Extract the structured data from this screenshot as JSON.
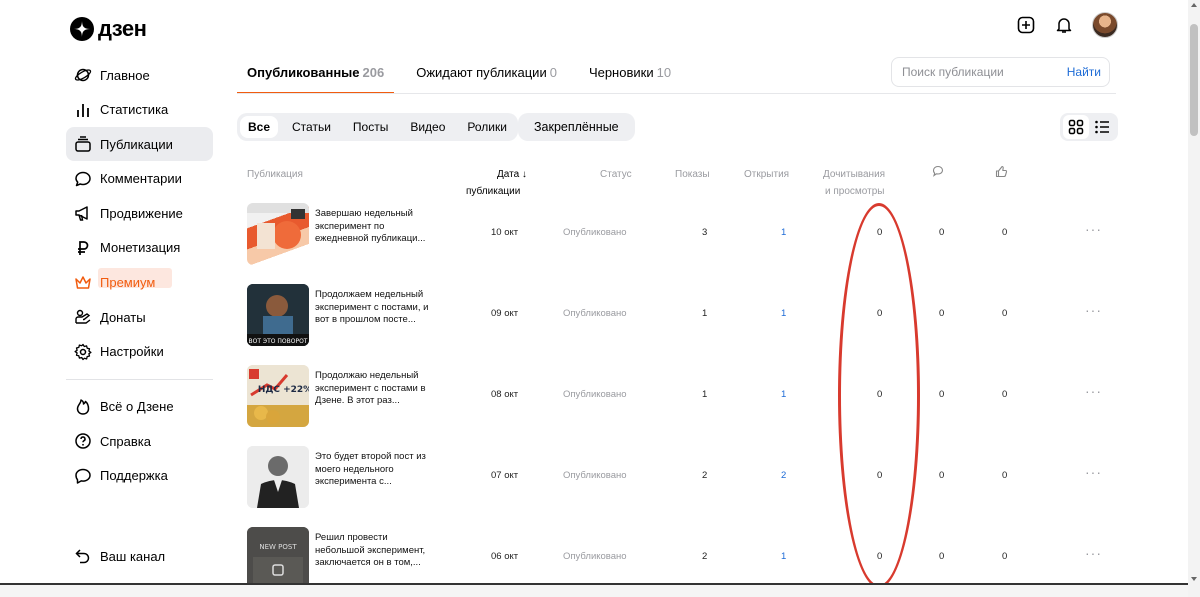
{
  "brand": {
    "name": "дзен"
  },
  "nav": {
    "items": [
      {
        "label": "Главное",
        "icon": "planet-icon"
      },
      {
        "label": "Статистика",
        "icon": "bar-chart-icon"
      },
      {
        "label": "Публикации",
        "icon": "stack-icon",
        "active": true
      },
      {
        "label": "Комментарии",
        "icon": "comment-icon"
      },
      {
        "label": "Продвижение",
        "icon": "megaphone-icon"
      },
      {
        "label": "Монетизация",
        "icon": "ruble-icon"
      },
      {
        "label": "Премиум",
        "icon": "crown-icon",
        "premium": true
      },
      {
        "label": "Донаты",
        "icon": "donate-icon"
      },
      {
        "label": "Настройки",
        "icon": "gear-icon"
      }
    ],
    "help": [
      {
        "label": "Всё о Дзене",
        "icon": "flame-icon"
      },
      {
        "label": "Справка",
        "icon": "question-icon"
      },
      {
        "label": "Поддержка",
        "icon": "support-icon"
      }
    ],
    "channel": {
      "label": "Ваш канал",
      "icon": "back-arrow-icon"
    }
  },
  "tabs": [
    {
      "label": "Опубликованные",
      "count": "206",
      "active": true
    },
    {
      "label": "Ожидают публикации",
      "count": "0"
    },
    {
      "label": "Черновики",
      "count": "10"
    }
  ],
  "search": {
    "placeholder": "Поиск публикации",
    "button": "Найти"
  },
  "filters": [
    "Все",
    "Статьи",
    "Посты",
    "Видео",
    "Ролики"
  ],
  "pinned_label": "Закреплённые",
  "table": {
    "headers": {
      "publication": "Публикация",
      "date_line1": "Дата",
      "date_line2": "публикации",
      "status": "Статус",
      "views": "Показы",
      "opens": "Открытия",
      "reads_line1": "Дочитывания",
      "reads_line2": "и просмотры"
    },
    "rows": [
      {
        "title": "Завершаю недельный эксперимент по ежедневной публикаци...",
        "date": "10 окт",
        "status": "Опубликовано",
        "views": "3",
        "opens": "1",
        "reads": "0",
        "comments": "0",
        "likes": "0"
      },
      {
        "title": "Продолжаем недельный эксперимент с постами, и вот в прошлом посте...",
        "date": "09 окт",
        "status": "Опубликовано",
        "views": "1",
        "opens": "1",
        "reads": "0",
        "comments": "0",
        "likes": "0",
        "thumb_caption": "ВОТ ЭТО ПОВОРОТ"
      },
      {
        "title": "Продолжаю недельный эксперимент с постами в Дзене. В этот раз...",
        "date": "08 окт",
        "status": "Опубликовано",
        "views": "1",
        "opens": "1",
        "reads": "0",
        "comments": "0",
        "likes": "0",
        "thumb_caption": "НДС +22%"
      },
      {
        "title": "Это будет второй пост из моего недельного эксперимента с...",
        "date": "07 окт",
        "status": "Опубликовано",
        "views": "2",
        "opens": "2",
        "reads": "0",
        "comments": "0",
        "likes": "0"
      },
      {
        "title": "Решил провести небольшой эксперимент, заключается он в том,...",
        "date": "06 окт",
        "status": "Опубликовано",
        "views": "2",
        "opens": "1",
        "reads": "0",
        "comments": "0",
        "likes": "0",
        "thumb_caption": "NEW POST"
      }
    ]
  },
  "colors": {
    "accent": "#f15c0f",
    "link": "#1d6bd6",
    "annotation": "#d83a2e"
  }
}
